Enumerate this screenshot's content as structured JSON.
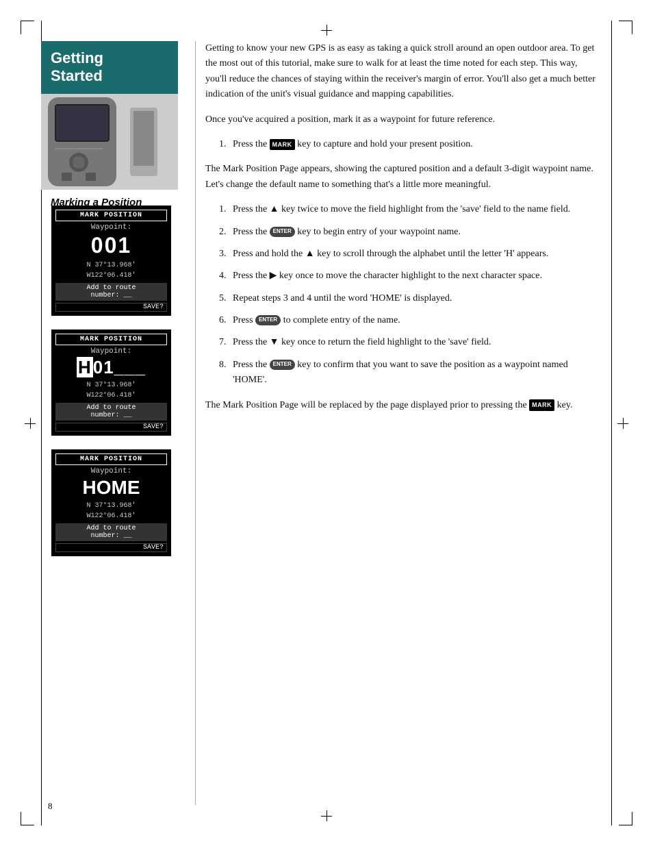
{
  "page": {
    "number": "8",
    "sidebar": {
      "title_line1": "Getting",
      "title_line2": "Started",
      "subtitle": "Marking a Position"
    },
    "intro": {
      "para1": "Getting to know your new GPS is as easy as taking a quick stroll around an open outdoor area. To get the most out of this tutorial, make sure to walk for at least the time noted for each step. This way, you'll reduce the chances of staying within the receiver's margin of error. You'll also get a much better indication of the unit's visual guidance and mapping capabilities.",
      "para2": "Once you've acquired a position, mark it as a waypoint for future reference."
    },
    "steps_group1": {
      "step1": {
        "num": "1.",
        "text_before": "Press the",
        "key": "MARK",
        "text_after": "key to capture and hold your present position."
      }
    },
    "between_para": "The Mark Position Page appears, showing the captured position and a default 3-digit waypoint name. Let's change the default name to something that's a little more meaningful.",
    "steps_group2": {
      "step1": {
        "num": "1.",
        "text": "Press the ▲ key twice to move the field highlight from the 'save' field to the name field."
      },
      "step2": {
        "num": "2.",
        "text_before": "Press the",
        "key": "ENTER",
        "text_after": "key to begin entry of your waypoint name."
      },
      "step3": {
        "num": "3.",
        "text": "Press and hold the ▲ key to scroll through the alphabet until the letter 'H' appears."
      },
      "step4": {
        "num": "4.",
        "text": "Press the ▶ key once to move the character highlight to the next character space."
      },
      "step5": {
        "num": "5.",
        "text": "Repeat steps 3 and 4 until the word 'HOME' is displayed."
      },
      "step6": {
        "num": "6.",
        "text_before": "Press",
        "key": "ENTER",
        "text_after": "to complete entry of the name."
      },
      "step7": {
        "num": "7.",
        "text": "Press the ▼ key once to return the field highlight to the 'save' field."
      },
      "step8": {
        "num": "8.",
        "text_before": "Press the",
        "key": "ENTER",
        "text_after": "key to confirm that you want to save the position as a waypoint named 'HOME'."
      }
    },
    "closing_para_before": "The Mark Position Page will be replaced by the page displayed prior to pressing the",
    "closing_key": "MARK",
    "closing_para_after": "key.",
    "screens": {
      "screen1": {
        "title": "MARK POSITION",
        "waypoint_label": "Waypoint:",
        "waypoint_value": "001",
        "coord1": "N 37°13.968'",
        "coord2": "W122°06.418'",
        "route_text": "Add to route\nnumber: __",
        "save_text": "SAVE?"
      },
      "screen2": {
        "title": "MARK POSITION",
        "waypoint_label": "Waypoint:",
        "waypoint_value": "H01___",
        "coord1": "N 37°13.968'",
        "coord2": "W122°06.418'",
        "route_text": "Add to route\nnumber: __",
        "save_text": "SAVE?"
      },
      "screen3": {
        "title": "MARK POSITION",
        "waypoint_label": "Waypoint:",
        "waypoint_value": "HOME",
        "coord1": "N 37°13.968'",
        "coord2": "W122°06.418'",
        "route_text": "Add to route\nnumber: __",
        "save_text": "SAVE?"
      }
    }
  }
}
